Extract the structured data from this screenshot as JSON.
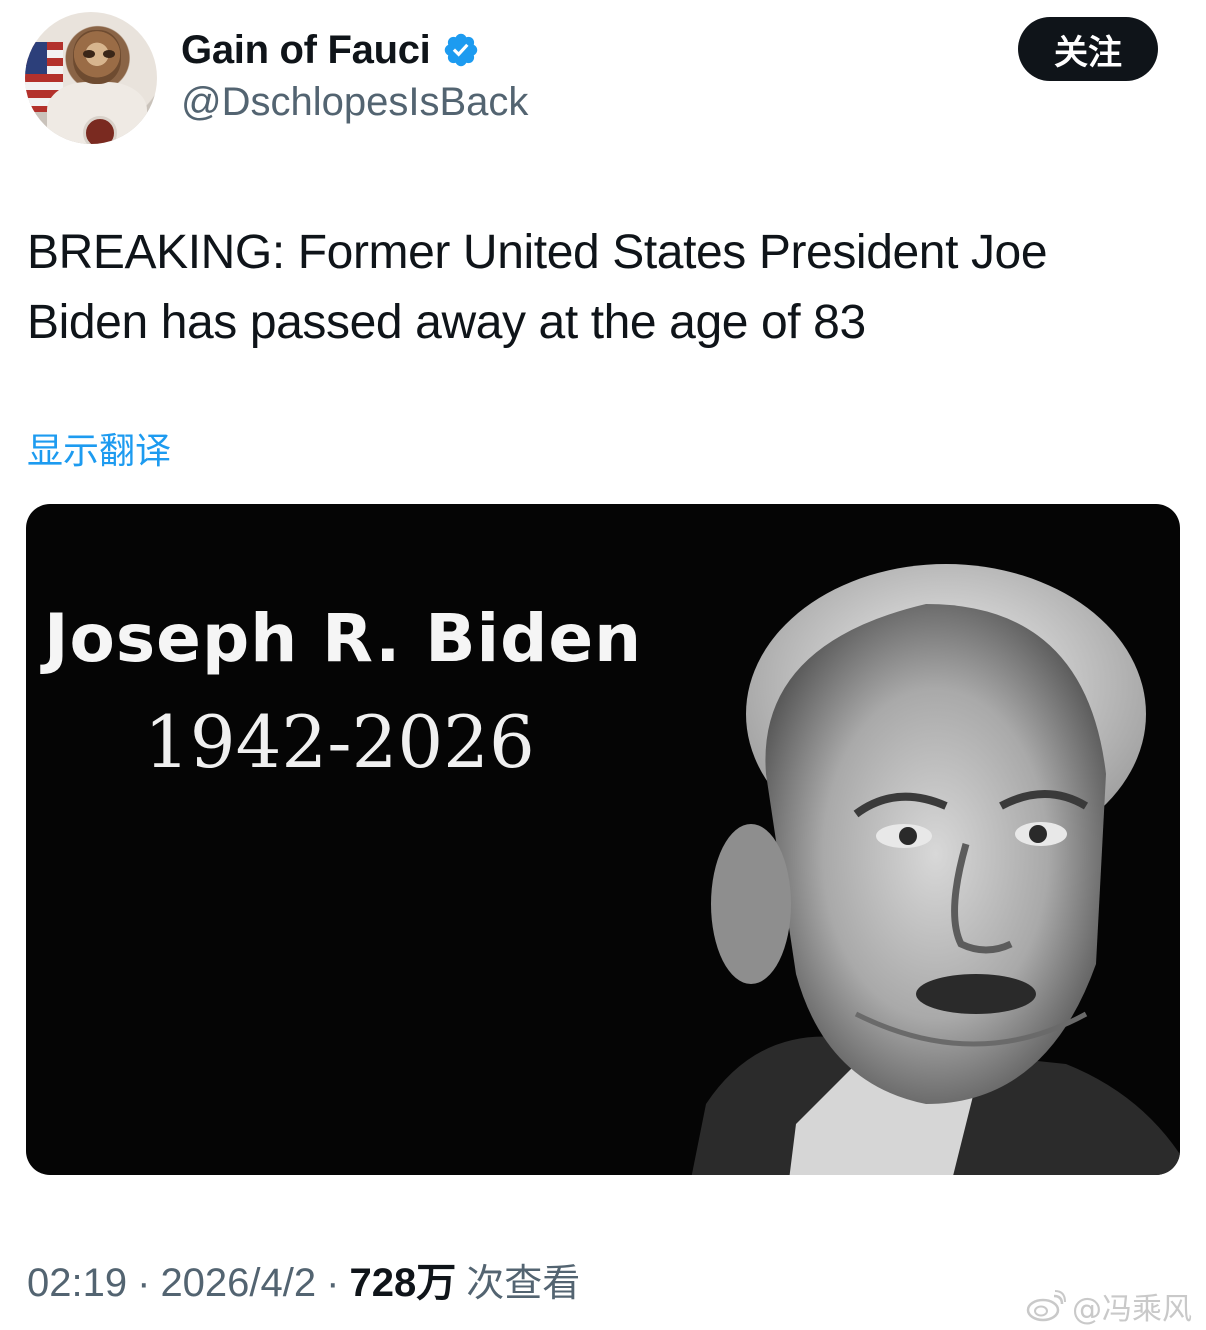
{
  "author": {
    "display_name": "Gain of Fauci",
    "handle": "@DschlopesIsBack",
    "verified": true,
    "verified_color": "#1d9bf0"
  },
  "follow_button": {
    "label": "关注"
  },
  "tweet": {
    "text": "BREAKING: Former United States President Joe Biden has passed away at the age of 83",
    "translate_label": "显示翻译"
  },
  "media": {
    "name_text": "Joseph R. Biden",
    "years_text": "1942-2026"
  },
  "meta": {
    "time": "02:19",
    "separator": "·",
    "date": "2026/4/2",
    "views_count": "728万",
    "views_label": "次查看"
  },
  "watermark": {
    "text": "@冯乘风",
    "icon": "weibo-icon"
  }
}
